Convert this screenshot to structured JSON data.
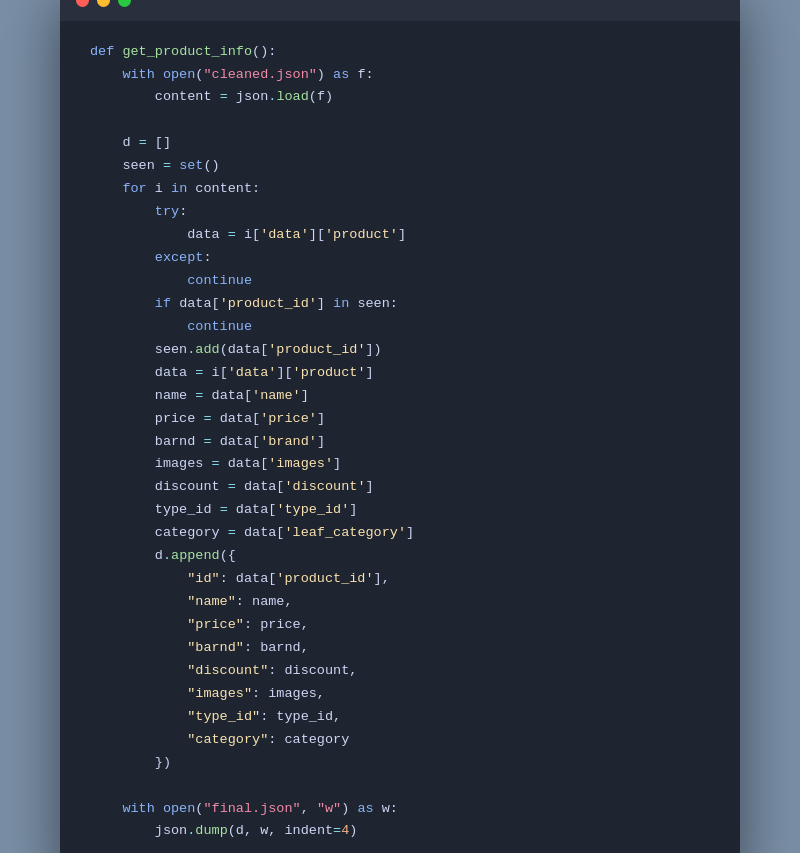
{
  "window": {
    "titlebar": {
      "dot_red": "close",
      "dot_yellow": "minimize",
      "dot_green": "maximize"
    }
  },
  "code": {
    "lines": [
      "def get_product_info():",
      "    with open(\"cleaned.json\") as f:",
      "        content = json.load(f)",
      "",
      "    d = []",
      "    seen = set()",
      "    for i in content:",
      "        try:",
      "            data = i['data']['product']",
      "        except:",
      "            continue",
      "        if data['product_id'] in seen:",
      "            continue",
      "        seen.add(data['product_id'])",
      "        data = i['data']['product']",
      "        name = data['name']",
      "        price = data['price']",
      "        barnd = data['brand']",
      "        images = data['images']",
      "        discount = data['discount']",
      "        type_id = data['type_id']",
      "        category = data['leaf_category']",
      "        d.append({",
      "            \"id\": data['product_id'],",
      "            \"name\": name,",
      "            \"price\": price,",
      "            \"barnd\": barnd,",
      "            \"discount\": discount,",
      "            \"images\": images,",
      "            \"type_id\": type_id,",
      "            \"category\": category",
      "        })",
      "",
      "    with open(\"final.json\", \"w\") as w:",
      "        json.dump(d, w, indent=4)"
    ]
  }
}
